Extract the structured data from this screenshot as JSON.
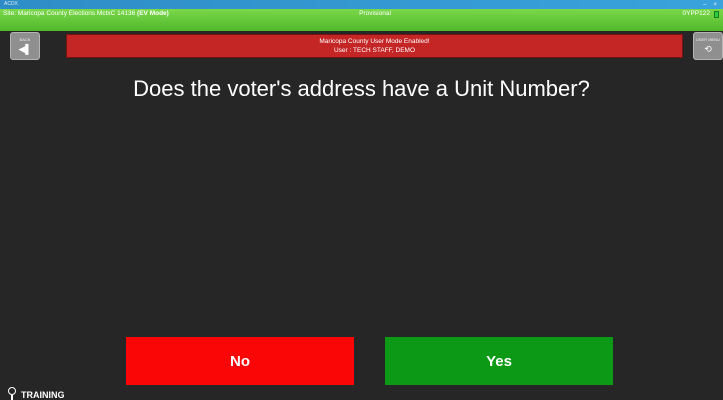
{
  "window": {
    "app_name": "ACDX",
    "minimize_glyph": "–",
    "close_glyph": "×"
  },
  "status_bar": {
    "site_prefix": "Site: Maricopa County Elections MctxC 14136 ",
    "site_mode": "(EV Mode)",
    "ballot_type": "Provisional",
    "device_id": "0YPP122",
    "battery_icon": "battery-icon",
    "color": "#5ec634"
  },
  "toolbar": {
    "back_button": {
      "caption": "BACK",
      "icon": "back-arrow-icon",
      "glyph": "◀▌"
    },
    "user_button": {
      "caption": "USER MENU",
      "icon": "user-menu-icon",
      "glyph": "⟲"
    }
  },
  "banner": {
    "line1": "Maricopa County User Mode Enabled!",
    "line2": "User : TECH STAFF, DEMO",
    "color": "#c42525"
  },
  "prompt": {
    "question": "Does the voter's address have a Unit Number?"
  },
  "answers": {
    "no_label": "No",
    "yes_label": "Yes",
    "no_color": "#fb0606",
    "yes_color": "#0c9a16"
  },
  "footer": {
    "training_label": "TRAINING",
    "training_icon": "pin-icon"
  }
}
